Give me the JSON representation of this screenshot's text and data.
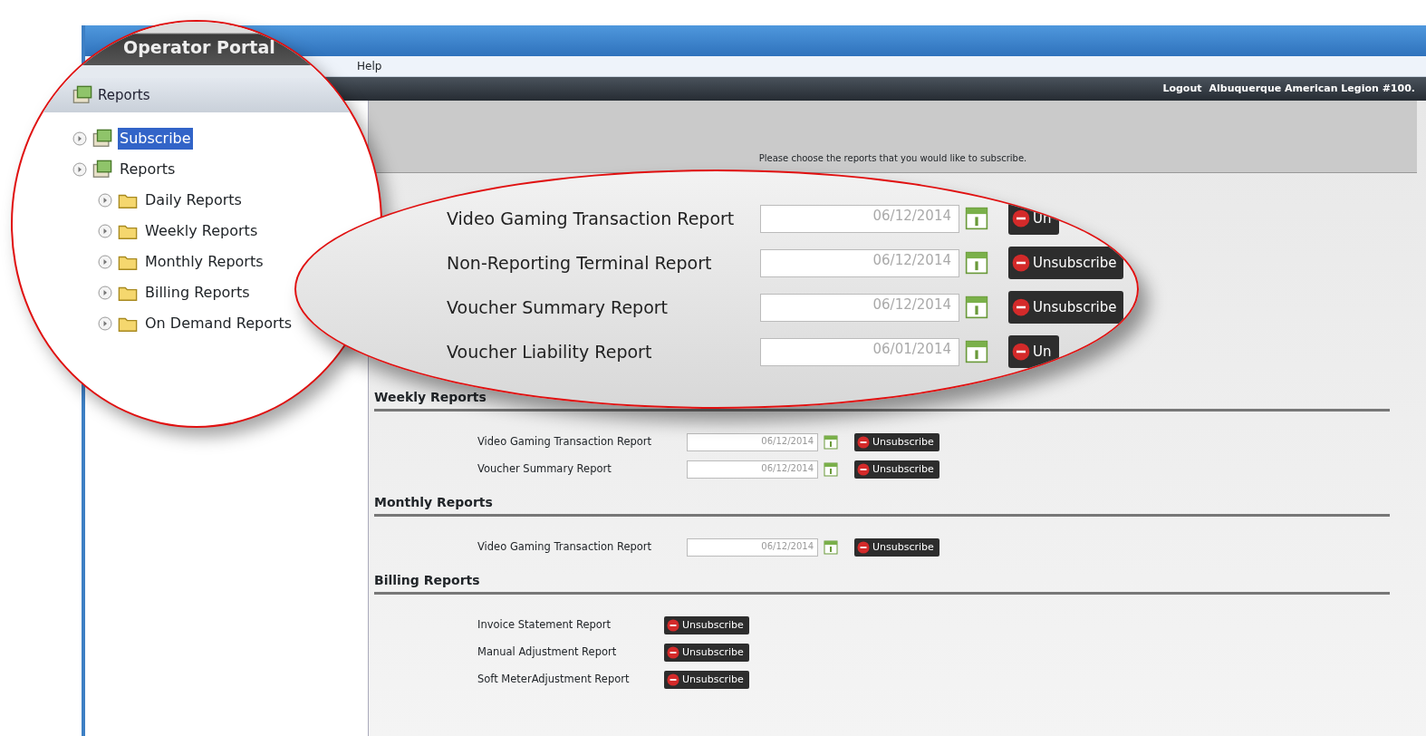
{
  "window": {
    "tab_title": "Operator Portal"
  },
  "menu": [
    "Help"
  ],
  "header": {
    "logout": "Logout",
    "account": "Albuquerque American Legion #100."
  },
  "sidebar": {
    "title": "Reports",
    "tree": [
      {
        "label": "Subscribe",
        "selected": true
      },
      {
        "label": "Reports",
        "selected": false,
        "children": [
          {
            "label": "Daily Reports",
            "selected": false
          },
          {
            "label": "Weekly Reports",
            "selected": false
          },
          {
            "label": "Monthly Reports",
            "selected": false
          },
          {
            "label": "Billing Reports",
            "selected": false
          },
          {
            "label": "On Demand Reports",
            "selected": false
          }
        ]
      }
    ]
  },
  "notice": "Please choose the reports that you would like to subscribe.",
  "daily_callout": {
    "rows": [
      {
        "label": "Video Gaming Transaction Report",
        "date": "06/12/2014",
        "button": "Un"
      },
      {
        "label": "Non-Reporting Terminal Report",
        "date": "06/12/2014",
        "button": "Unsubscribe"
      },
      {
        "label": "Voucher Summary Report",
        "date": "06/12/2014",
        "button": "Unsubscribe"
      },
      {
        "label": "Voucher Liability Report",
        "date": "06/01/2014",
        "button": "Un"
      }
    ]
  },
  "sections": [
    {
      "title": "Weekly Reports",
      "rows": [
        {
          "label": "Video Gaming Transaction Report",
          "date": "06/12/2014",
          "button": "Unsubscribe"
        },
        {
          "label": "Voucher Summary Report",
          "date": "06/12/2014",
          "button": "Unsubscribe"
        }
      ]
    },
    {
      "title": "Monthly Reports",
      "rows": [
        {
          "label": "Video Gaming Transaction Report",
          "date": "06/12/2014",
          "button": "Unsubscribe"
        }
      ]
    },
    {
      "title": "Billing Reports",
      "rows": [
        {
          "label": "Invoice Statement Report",
          "button": "Unsubscribe"
        },
        {
          "label": "Manual Adjustment Report",
          "button": "Unsubscribe"
        },
        {
          "label": "Soft MeterAdjustment Report",
          "button": "Unsubscribe"
        }
      ]
    }
  ]
}
